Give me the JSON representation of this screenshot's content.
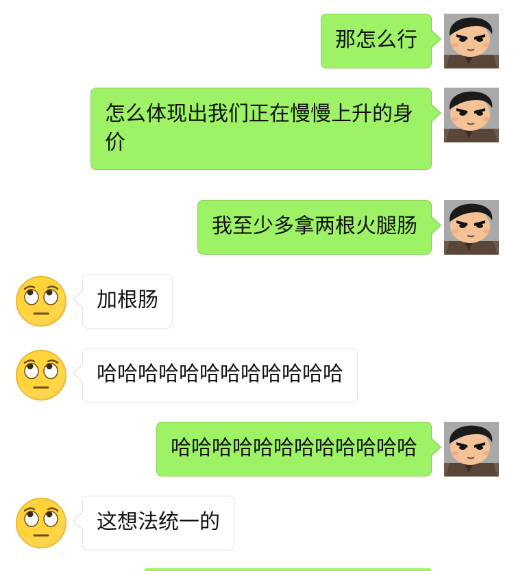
{
  "colors": {
    "my_bubble": "#9ef265",
    "other_bubble": "#ffffff",
    "background": "#ffffff"
  },
  "messages": [
    {
      "sender": "me",
      "avatar": "cartoon-boy-avatar-icon",
      "text": "那怎么行"
    },
    {
      "sender": "me",
      "avatar": "cartoon-boy-avatar-icon",
      "text": "怎么体现出我们正在慢慢上升的身价"
    },
    {
      "sender": "me",
      "avatar": "cartoon-boy-avatar-icon",
      "text": "我至少多拿两根火腿肠"
    },
    {
      "sender": "other",
      "avatar": "eye-roll-emoji-avatar-icon",
      "text": "加根肠"
    },
    {
      "sender": "other",
      "avatar": "eye-roll-emoji-avatar-icon",
      "text": "哈哈哈哈哈哈哈哈哈哈哈哈"
    },
    {
      "sender": "me",
      "avatar": "cartoon-boy-avatar-icon",
      "text": "哈哈哈哈哈哈哈哈哈哈哈哈"
    },
    {
      "sender": "other",
      "avatar": "eye-roll-emoji-avatar-icon",
      "text": "这想法统一的"
    }
  ]
}
